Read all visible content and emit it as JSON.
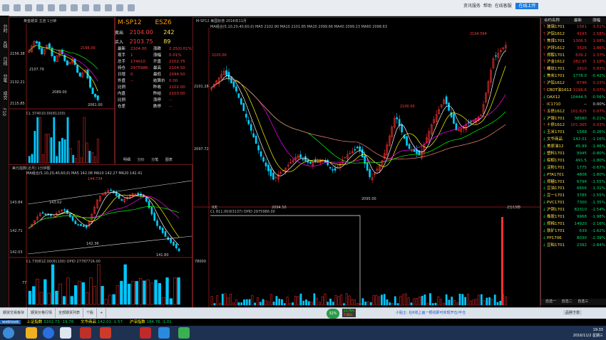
{
  "app": {
    "brand": "webtook",
    "right_menu": [
      "资讯服务",
      "帮助",
      "在线客服",
      "在线上传"
    ]
  },
  "left_rail": [
    "分时",
    "K线",
    "日线",
    "分笔",
    "成交",
    "F10"
  ],
  "panels": {
    "topleft": {
      "title": "黄金期货 主连 1分钟 ",
      "ticks": [
        "2156.38",
        "2132.21",
        "2115.85"
      ],
      "labels": {
        "hi": "2166.00",
        "lo": "2061.00",
        "mid": "2107.79",
        "l1": "2089.00"
      },
      "vol": "CL  374010.00(81100)"
    },
    "quote": {
      "symbol": "M-SP12",
      "code": "ESZ6",
      "rows": [
        {
          "k": "卖出",
          "v": "2104.00",
          "x": "242"
        },
        {
          "k": "买入",
          "v": "2103.75",
          "x": "89"
        },
        {
          "k": "最新",
          "v": "2104.00",
          "k2": "涨跌",
          "v2": "2.25(0.01%)"
        },
        {
          "k": "现手",
          "v": "1",
          "k2": "涨幅",
          "v2": "0.01%"
        },
        {
          "k": "总手",
          "v": "174010",
          "k2": "开盘",
          "v2": "2102.75"
        },
        {
          "k": "持仓",
          "v": "2975986",
          "k2": "最高",
          "v2": "2104.50"
        },
        {
          "k": "日增",
          "v": "0",
          "k2": "最低",
          "v2": "2094.50"
        },
        {
          "k": "外盘",
          "v": "--",
          "k2": "结算价",
          "v2": "0.00"
        },
        {
          "k": "比例",
          "v": "",
          "k2": "昨收",
          "v2": "2102.00"
        },
        {
          "k": "内盘",
          "v": "",
          "k2": "昨结",
          "v2": "2103.00"
        },
        {
          "k": "比例",
          "v": "",
          "k2": "涨停",
          "v2": "--"
        },
        {
          "k": "仓差",
          "v": "",
          "k2": "跌停",
          "v2": "--"
        }
      ],
      "tabs": [
        "明细",
        "分价",
        "分笔",
        "图表"
      ]
    },
    "bottomleft": {
      "title": "美元指数(近月) 1分钟图",
      "ma": "MA组合(5,10,20,40,60,0)  MA5 142.08  MA10 142.27  MA20 142.41",
      "ticks": [
        "143.84",
        "142.71",
        "142.03"
      ],
      "labels": {
        "a": "144.734",
        "b": "143.02",
        "c": "142.36",
        "d": "141.80"
      },
      "vol": "CL  73081Z.00(81100)   OPID  27787716.00",
      "vol_tick": "77"
    },
    "main": {
      "title": "M-SP12   美国标普  2016年11月",
      "ma": "MA组合(5,10,20,40,60,0)  MA5 2102.90  MA10 2101.85  MA20 2099.66  MA40 2099.23  MA60 2098.63",
      "ticks": [
        "2101.28",
        "2097.72"
      ],
      "labels": {
        "hi": "2104.564",
        "l1": "2103.00",
        "l2": "2100.00",
        "lo": "2094.50",
        "lo2": "2095.00",
        "start": "9天",
        "end": "2分15秒"
      },
      "vol": "CL  811.00(63137)   OPID  2975986.00",
      "vol_tick": "78000"
    }
  },
  "rightlist": {
    "header": [
      "合约名称",
      "最新",
      "涨幅"
    ],
    "items": [
      {
        "n": "玻璃1701",
        "p": "1581",
        "c": "3.51%",
        "up": true
      },
      {
        "n": "沪铝1612",
        "p": "4193",
        "c": "2.58%",
        "up": true
      },
      {
        "n": "焦煤1701",
        "p": "1306.5",
        "c": "1.08%",
        "up": true
      },
      {
        "n": "沪锌1612",
        "p": "3526",
        "c": "1.86%",
        "up": true
      },
      {
        "n": "郑醇1701",
        "p": "639.2",
        "c": "1.37%",
        "up": true
      },
      {
        "n": "沪金1612",
        "p": "282.95",
        "c": "1.18%",
        "up": true
      },
      {
        "n": "螺纹1701",
        "p": "2610",
        "c": "0.83%",
        "up": true
      },
      {
        "n": "焦炭1701",
        "p": "1778.0",
        "c": "-0.42%",
        "up": false
      },
      {
        "n": "沪铅1612",
        "p": "6746",
        "c": "0.23%",
        "up": true
      },
      {
        "n": "CBOT油1612",
        "p": "3296.6",
        "c": "0.07%",
        "up": true
      },
      {
        "n": "DAX12",
        "p": "10444.5",
        "c": "-0.56%",
        "up": false
      },
      {
        "n": "IC1710",
        "p": "--",
        "c": "0.00%",
        "up": null
      },
      {
        "n": "五债1612",
        "p": "101.825",
        "c": "0.07%",
        "up": true
      },
      {
        "n": "沪镍1701",
        "p": "38580",
        "c": "-0.21%",
        "up": false
      },
      {
        "n": "十债1612",
        "p": "101.365",
        "c": "0.03%",
        "up": true
      },
      {
        "n": "玉米1701",
        "p": "1588",
        "c": "-0.26%",
        "up": false
      },
      {
        "n": "文华商品",
        "p": "142.01",
        "c": "-1.16%",
        "up": false
      },
      {
        "n": "美原油12",
        "p": "45.99",
        "c": "-1.46%",
        "up": false
      },
      {
        "n": "塑料1701",
        "p": "9945",
        "c": "-0.80%",
        "up": false
      },
      {
        "n": "棕榈1701",
        "p": "491.5",
        "c": "-1.80%",
        "up": false
      },
      {
        "n": "淀粉1701",
        "p": "1775",
        "c": "-0.67%",
        "up": false
      },
      {
        "n": "PTA1701",
        "p": "4806",
        "c": "-1.80%",
        "up": false
      },
      {
        "n": "郑糖1701",
        "p": "6796",
        "c": "-1.55%",
        "up": false
      },
      {
        "n": "豆油1701",
        "p": "6656",
        "c": "-1.31%",
        "up": false
      },
      {
        "n": "豆一1701",
        "p": "3785",
        "c": "-1.55%",
        "up": false
      },
      {
        "n": "PVC1701",
        "p": "7300",
        "c": "-1.35%",
        "up": false
      },
      {
        "n": "沪铜1701",
        "p": "82310",
        "c": "-1.54%",
        "up": false
      },
      {
        "n": "橡胶1701",
        "p": "9968",
        "c": "-1.98%",
        "up": false
      },
      {
        "n": "郑棉1701",
        "p": "14920",
        "c": "-2.16%",
        "up": false
      },
      {
        "n": "铁矿1701",
        "p": "639",
        "c": "-1.62%",
        "up": false
      },
      {
        "n": "PP1706",
        "p": "8030",
        "c": "-2.39%",
        "up": false
      },
      {
        "n": "豆粕1701",
        "p": "2392",
        "c": "-2.84%",
        "up": false
      }
    ],
    "tabs": [
      "自选一",
      "自选二",
      "自选三"
    ]
  },
  "statusbar": {
    "tabs": [
      "期货交易板块",
      "期货价格行情",
      "全部期货列表",
      "个股",
      "+"
    ],
    "extra": "品种下单",
    "pct": "32%",
    "net_up": "13.7K/s",
    "net_dn": "7.6K/s",
    "notice": "小贴士: 在K线上画一根线即可实现开仓/平仓"
  },
  "ticker": [
    {
      "t": "上证指数",
      "v": "3102.73",
      "d": "-19.78",
      "up": false
    },
    {
      "t": "文华商品",
      "v": "142.01",
      "d": "-1.57",
      "up": false
    },
    {
      "t": "沪深指数",
      "v": "184.76",
      "d": "-1.01",
      "up": false
    }
  ],
  "clock": {
    "time": "19:33",
    "date": "2016/11/2 星期三"
  },
  "colors": {
    "up": "#ff3030",
    "down": "#00d0ff",
    "ma5": "#ffffff",
    "ma10": "#ffff00",
    "ma20": "#ff00ff",
    "ma40": "#00ff00",
    "ma60": "#ff8080",
    "axis": "#aa2020"
  }
}
